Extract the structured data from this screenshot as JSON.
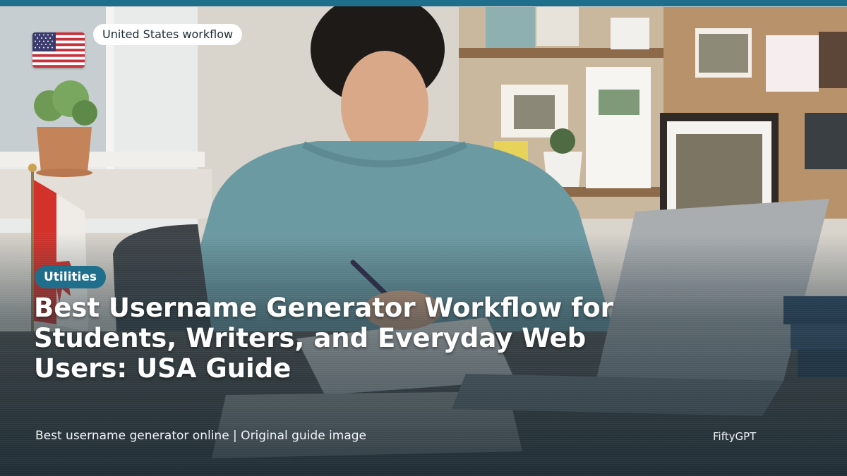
{
  "hero": {
    "photo_description_icon": "student-writing-at-desk-photo",
    "accent_color": "#1f6e8c"
  },
  "region": {
    "flag_icon": "us-flag-icon",
    "label": "United States workflow"
  },
  "category": {
    "label": "Utilities"
  },
  "headline": {
    "line1": "Best Username Generator Workflow for",
    "line2": "Students, Writers, and Everyday Web",
    "line3": "Users: USA Guide"
  },
  "footer": {
    "caption": "Best username generator online | Original guide image",
    "brand": "FiftyGPT"
  }
}
